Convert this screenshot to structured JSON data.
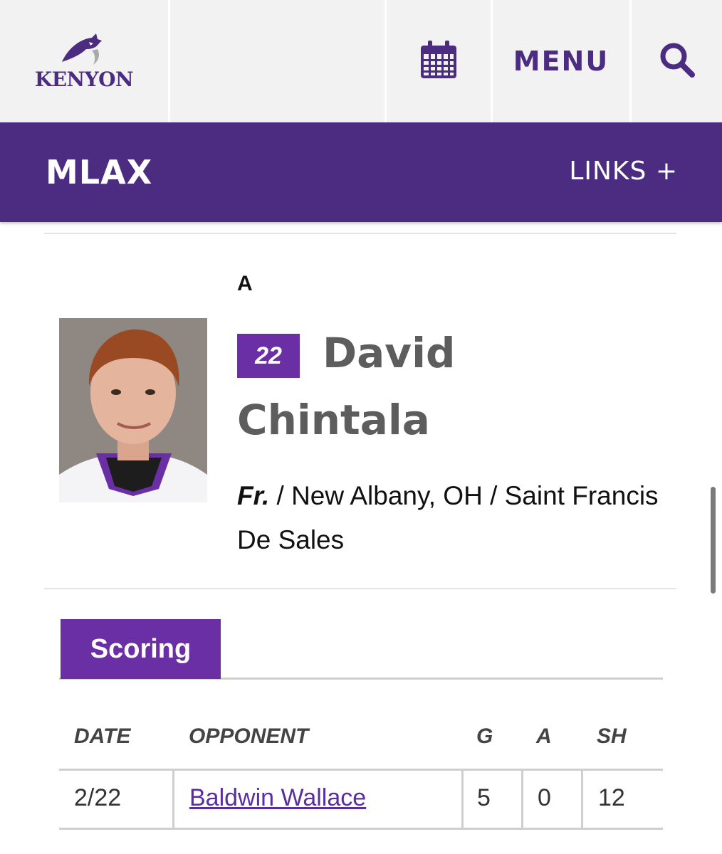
{
  "header": {
    "logo_text": "KENYON",
    "menu_label": "MENU"
  },
  "sport_bar": {
    "title": "MLAX",
    "links_label": "LINKS +"
  },
  "player": {
    "position": "A",
    "jersey_number": "22",
    "first_name": "David",
    "last_name": "Chintala",
    "class_year": "Fr.",
    "hometown_school": " / New Albany, OH / Saint Francis De Sales"
  },
  "stats_tab": {
    "label": "Scoring"
  },
  "table": {
    "headers": {
      "date": "DATE",
      "opponent": "OPPONENT",
      "g": "G",
      "a": "A",
      "sh": "SH"
    },
    "rows": [
      {
        "date": "2/22",
        "opponent": "Baldwin Wallace",
        "g": "5",
        "a": "0",
        "sh": "12"
      }
    ]
  },
  "colors": {
    "brand_purple": "#4b2c80",
    "accent_purple": "#6b2fa5",
    "header_bg": "#f2f2f2"
  },
  "icons": {
    "calendar": "calendar-icon",
    "search": "search-icon",
    "logo": "lord-logo-icon"
  }
}
